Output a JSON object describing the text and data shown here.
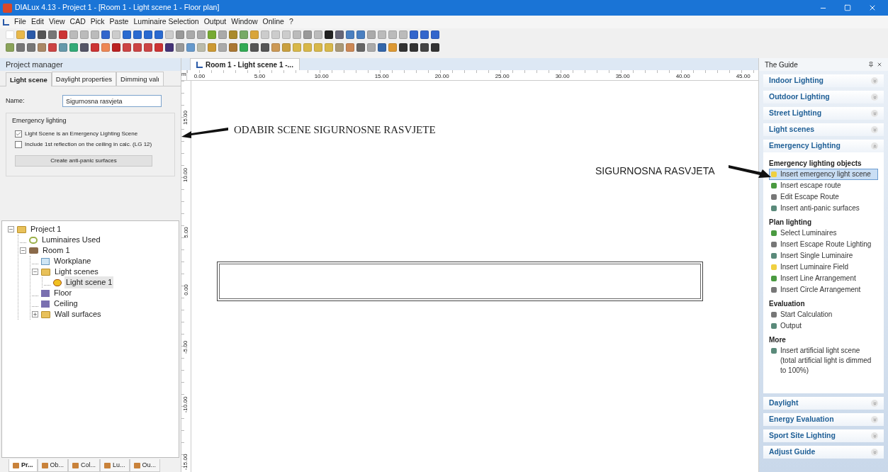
{
  "window": {
    "title": "DIALux 4.13 - Project 1 - [Room 1 - Light scene 1 - Floor plan]"
  },
  "menu": [
    "File",
    "Edit",
    "View",
    "CAD",
    "Pick",
    "Paste",
    "Luminaire Selection",
    "Output",
    "Window",
    "Online",
    "?"
  ],
  "project_manager": {
    "title": "Project manager",
    "tabs": [
      {
        "label": "Light scene",
        "selected": true
      },
      {
        "label": "Daylight properties",
        "selected": false
      },
      {
        "label": "Dimming valı",
        "selected": false
      }
    ],
    "name_label": "Name:",
    "name_value": "Sigurnosna rasvjeta",
    "group_title": "Emergency lighting",
    "options": [
      {
        "label": "Light Scene is an Emergency Lighting Scene",
        "checked": true
      },
      {
        "label": "Include 1st reflection on the ceiling in calc. (LG 12)",
        "checked": false
      }
    ],
    "action_button": "Create anti-panic surfaces",
    "tree": [
      {
        "label": "Project 1",
        "kind": "folder",
        "expanded": true,
        "selected": false,
        "children": [
          {
            "label": "Luminaires Used",
            "kind": "luminaires",
            "selected": false
          },
          {
            "label": "Room 1",
            "kind": "room",
            "expanded": true,
            "selected": false,
            "children": [
              {
                "label": "Workplane",
                "kind": "plane",
                "selected": false
              },
              {
                "label": "Light scenes",
                "kind": "folder",
                "expanded": true,
                "selected": false,
                "children": [
                  {
                    "label": "Light scene 1",
                    "kind": "scene",
                    "selected": true
                  }
                ]
              },
              {
                "label": "Floor",
                "kind": "surface",
                "selected": false
              },
              {
                "label": "Ceiling",
                "kind": "surface",
                "selected": false
              },
              {
                "label": "Wall surfaces",
                "kind": "folder",
                "expanded": false,
                "selected": false
              }
            ]
          }
        ]
      }
    ],
    "bottom_tabs": [
      {
        "label": "Pr...",
        "selected": true
      },
      {
        "label": "Ob...",
        "selected": false
      },
      {
        "label": "Col...",
        "selected": false
      },
      {
        "label": "Lu...",
        "selected": false
      },
      {
        "label": "Ou...",
        "selected": false
      }
    ]
  },
  "document": {
    "tab": "Room 1 - Light scene 1 -...",
    "unit": "m",
    "x_ruler": [
      "0.00",
      "5.00",
      "10.00",
      "15.00",
      "20.00",
      "25.00",
      "30.00",
      "35.00",
      "40.00",
      "45.00"
    ],
    "y_ruler": [
      "15.00",
      "10.00",
      "5.00",
      "0.00",
      "-5.00",
      "-10.00",
      "-15.00"
    ],
    "annotations": [
      "ODABIR SCENE SIGURNOSNE RASVJETE",
      "SIGURNOSNA RASVJETA"
    ]
  },
  "guide": {
    "title": "The Guide",
    "sections": [
      {
        "title": "Indoor Lighting",
        "expanded": false
      },
      {
        "title": "Outdoor Lighting",
        "expanded": false
      },
      {
        "title": "Street Lighting",
        "expanded": false
      },
      {
        "title": "Light scenes",
        "expanded": false
      },
      {
        "title": "Emergency Lighting",
        "expanded": true,
        "groups": [
          {
            "title": "Emergency lighting objects",
            "items": [
              {
                "label": "Insert emergency light scene",
                "selected": true
              },
              {
                "label": "Insert escape route",
                "selected": false
              },
              {
                "label": "Edit Escape Route",
                "selected": false
              },
              {
                "label": "Insert anti-panic surfaces",
                "selected": false
              }
            ]
          },
          {
            "title": "Plan lighting",
            "items": [
              {
                "label": "Select Luminaires",
                "selected": false
              },
              {
                "label": "Insert Escape Route Lighting",
                "selected": false
              },
              {
                "label": "Insert Single Luminaire",
                "selected": false
              },
              {
                "label": "Insert Luminaire Field",
                "selected": false
              },
              {
                "label": "Insert Line Arrangement",
                "selected": false
              },
              {
                "label": "Insert Circle Arrangement",
                "selected": false
              }
            ]
          },
          {
            "title": "Evaluation",
            "items": [
              {
                "label": "Start Calculation",
                "selected": false
              },
              {
                "label": "Output",
                "selected": false
              }
            ]
          },
          {
            "title": "More",
            "items": [
              {
                "label": "Insert artificial light scene (total artificial light is dimmed to 100%)",
                "selected": false
              }
            ]
          }
        ]
      },
      {
        "title": "Daylight",
        "expanded": false
      },
      {
        "title": "Energy Evaluation",
        "expanded": false
      },
      {
        "title": "Sport Site Lighting",
        "expanded": false
      },
      {
        "title": "Adjust Guide",
        "expanded": false
      }
    ]
  }
}
